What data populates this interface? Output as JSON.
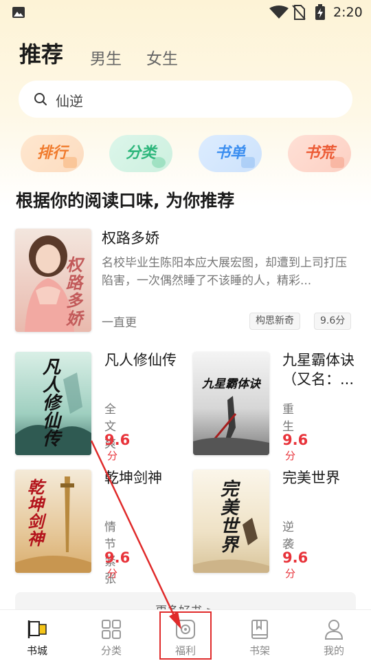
{
  "status_bar": {
    "time": "2:20"
  },
  "tabs": {
    "active": "推荐",
    "male": "男生",
    "female": "女生"
  },
  "search": {
    "value": "仙逆"
  },
  "quick_actions": [
    {
      "label": "排行",
      "color": "#f07a2c"
    },
    {
      "label": "分类",
      "color": "#2db67b"
    },
    {
      "label": "书单",
      "color": "#3b8ef0"
    },
    {
      "label": "书荒",
      "color": "#ec5a34"
    }
  ],
  "section": {
    "title": "根据你的阅读口味, 为你推荐"
  },
  "featured": {
    "title": "权路多娇",
    "description": "名校毕业生陈阳本应大展宏图，却遭到上司打压陷害，一次偶然睡了不该睡的人，精彩...",
    "status": "一直更",
    "tags": [
      "构思新奇",
      "9.6分"
    ],
    "cover_text": "权路多娇"
  },
  "books": [
    {
      "title": "凡人修仙传",
      "tag": "全文爽",
      "score": "9.6",
      "unit": "分",
      "cover_text": "凡人修仙传"
    },
    {
      "title": "九星霸体诀（又名：...",
      "tag": "重生",
      "score": "9.6",
      "unit": "分",
      "cover_text": "九星霸体诀"
    },
    {
      "title": "乾坤剑神",
      "tag": "情节紧张",
      "score": "9.6",
      "unit": "分",
      "cover_text": "乾坤剑神"
    },
    {
      "title": "完美世界",
      "tag": "逆袭",
      "score": "9.6",
      "unit": "分",
      "cover_text": "完美世界"
    }
  ],
  "more": {
    "label": "更多好书 >"
  },
  "bottom_nav": [
    {
      "label": "书城",
      "icon": "flag-icon",
      "active": true
    },
    {
      "label": "分类",
      "icon": "grid-icon",
      "active": false
    },
    {
      "label": "福利",
      "icon": "coupon-icon",
      "active": false
    },
    {
      "label": "书架",
      "icon": "book-icon",
      "active": false
    },
    {
      "label": "我的",
      "icon": "user-icon",
      "active": false
    }
  ],
  "colors": {
    "accent_red": "#e8333a",
    "annotation_red": "#e02a2a",
    "header_bg": "#fdf3d6"
  }
}
